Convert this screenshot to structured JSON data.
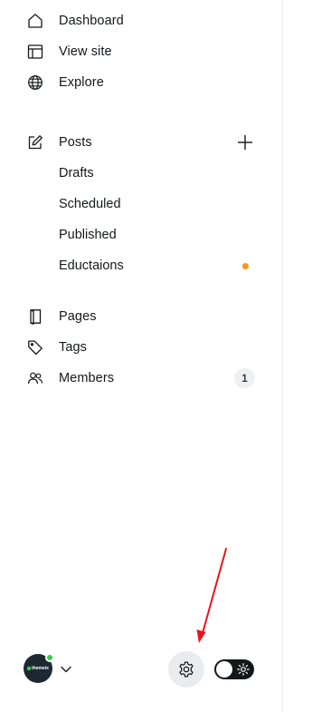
{
  "nav": {
    "dashboard": {
      "label": "Dashboard",
      "icon": "home-icon"
    },
    "view_site": {
      "label": "View site",
      "icon": "layout-icon"
    },
    "explore": {
      "label": "Explore",
      "icon": "globe-icon"
    },
    "posts": {
      "label": "Posts",
      "icon": "edit-icon"
    },
    "posts_sub": [
      {
        "label": "Drafts"
      },
      {
        "label": "Scheduled"
      },
      {
        "label": "Published"
      },
      {
        "label": "Eductaions",
        "has_indicator": true
      }
    ],
    "pages": {
      "label": "Pages",
      "icon": "page-icon"
    },
    "tags": {
      "label": "Tags",
      "icon": "tag-icon"
    },
    "members": {
      "label": "Members",
      "icon": "members-icon",
      "count": "1"
    }
  },
  "footer": {
    "avatar_text": "themeix",
    "settings_icon": "gear-icon",
    "theme_toggle": {
      "state": "light",
      "icon": "sun-icon"
    }
  },
  "annotation": {
    "color": "#e8141c",
    "icon": "red-arrow"
  },
  "colors": {
    "text": "#15171a",
    "indicator": "#f59324",
    "online": "#30cf43",
    "badge_bg": "#eef0f2"
  }
}
